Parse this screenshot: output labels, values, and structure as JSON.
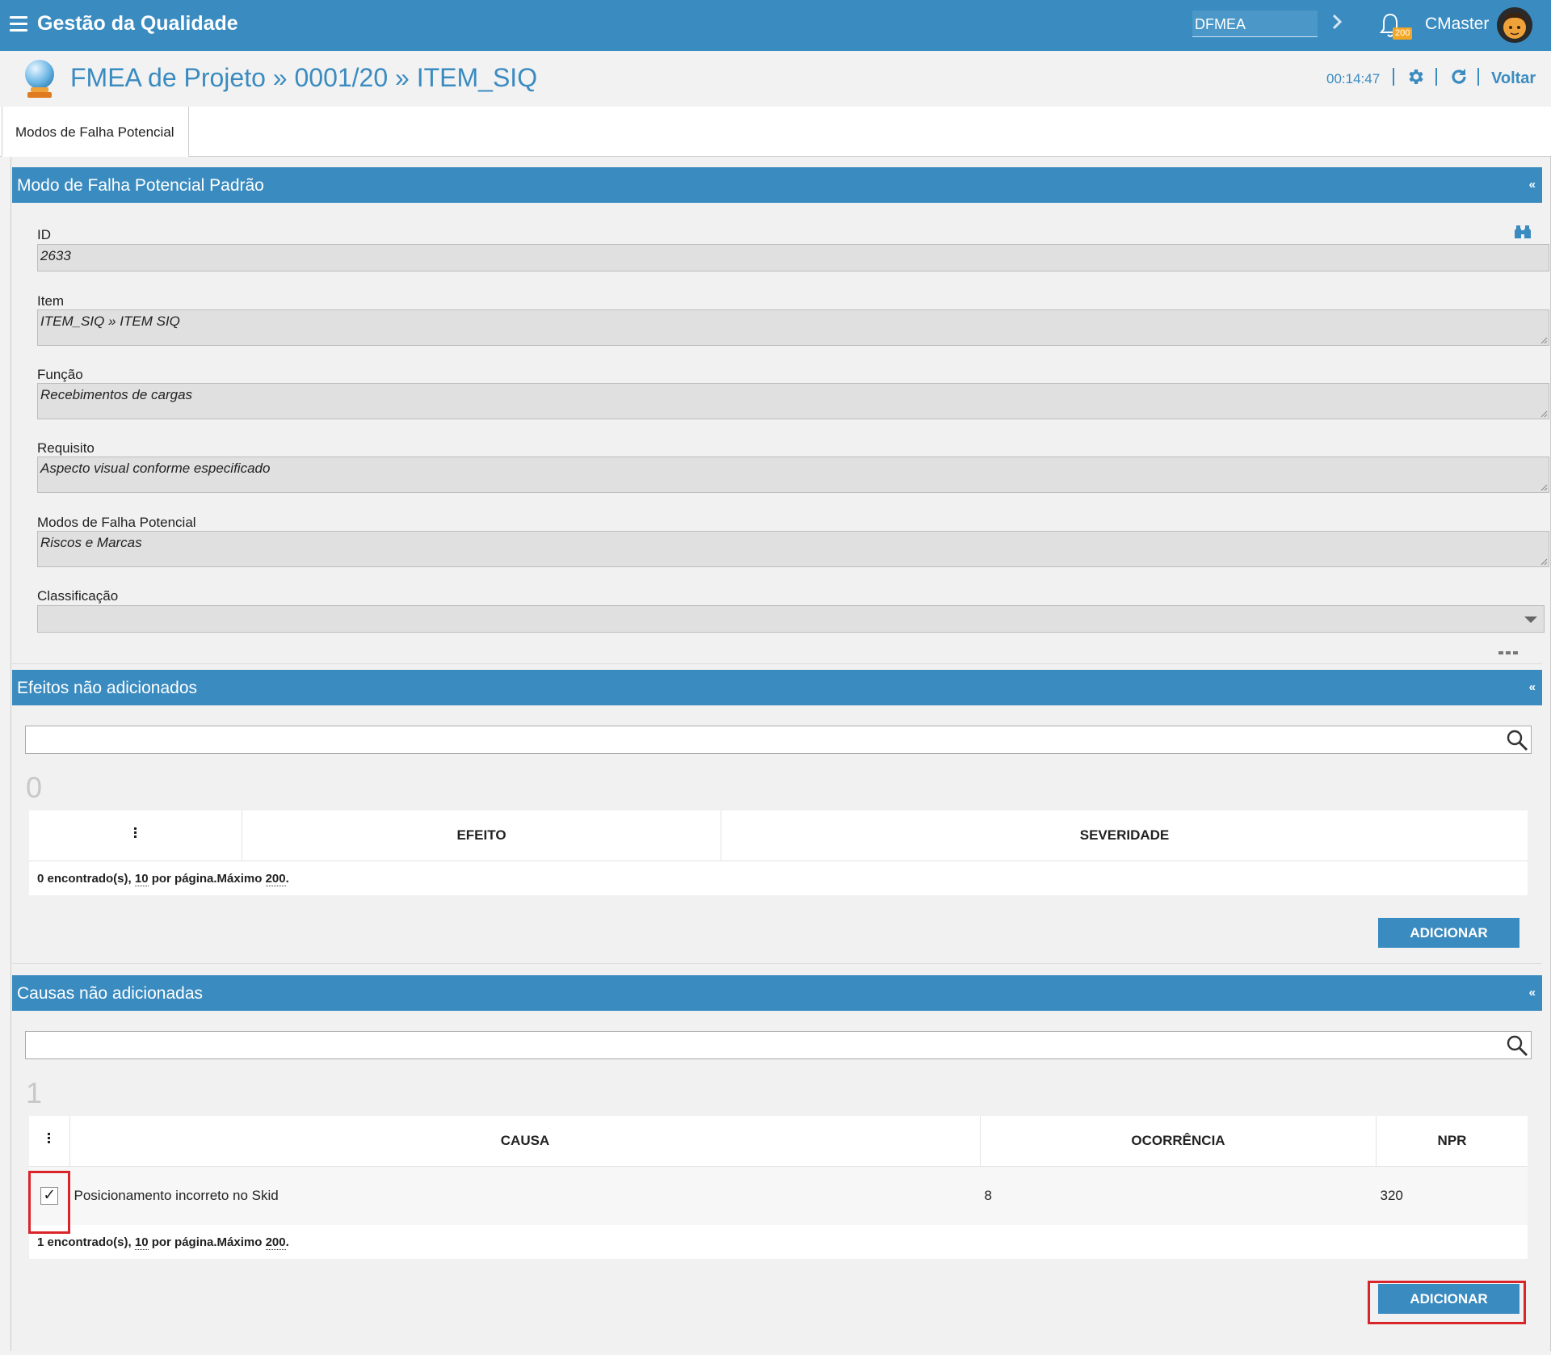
{
  "app": {
    "title": "Gestão da Qualidade",
    "module": "DFMEA",
    "notifications_count": "200",
    "user": "CMaster"
  },
  "header": {
    "title": "FMEA de Projeto » 0001/20 » ITEM_SIQ",
    "clock": "00:14:47",
    "back_label": "Voltar"
  },
  "tabs": [
    {
      "label": "Modos de Falha Potencial"
    }
  ],
  "panel_main": {
    "title": "Modo de Falha Potencial Padrão",
    "collapse": "«",
    "fields": {
      "id_label": "ID",
      "id_value": "2633",
      "item_label": "Item",
      "item_value": "ITEM_SIQ » ITEM SIQ",
      "funcao_label": "Função",
      "funcao_value": "Recebimentos de cargas",
      "requisito_label": "Requisito",
      "requisito_value": "Aspecto visual conforme especificado",
      "modos_label": "Modos de Falha Potencial",
      "modos_value": "Riscos e Marcas",
      "classificacao_label": "Classificação",
      "classificacao_value": ""
    }
  },
  "panel_efeitos": {
    "title": "Efeitos não adicionados",
    "collapse": "«",
    "search_value": "",
    "count": "0",
    "columns": [
      "EFEITO",
      "SEVERIDADE"
    ],
    "footer": {
      "found": "0 encontrado(s), ",
      "per_page": "10",
      "per_page_text": " por página.Máximo ",
      "max": "200",
      "end": "."
    },
    "add_label": "ADICIONAR"
  },
  "panel_causas": {
    "title": "Causas não adicionadas",
    "collapse": "«",
    "search_value": "",
    "count": "1",
    "columns": [
      "CAUSA",
      "OCORRÊNCIA",
      "NPR"
    ],
    "rows": [
      {
        "checked": "✓",
        "causa": "Posicionamento incorreto no Skid",
        "ocorrencia": "8",
        "npr": "320"
      }
    ],
    "footer": {
      "found": "1 encontrado(s), ",
      "per_page": "10",
      "per_page_text": " por página.Máximo ",
      "max": "200",
      "end": "."
    },
    "add_label": "ADICIONAR"
  },
  "colors": {
    "primary": "#3a8bc0",
    "highlight": "#d9252a",
    "badge": "#f5a623"
  }
}
